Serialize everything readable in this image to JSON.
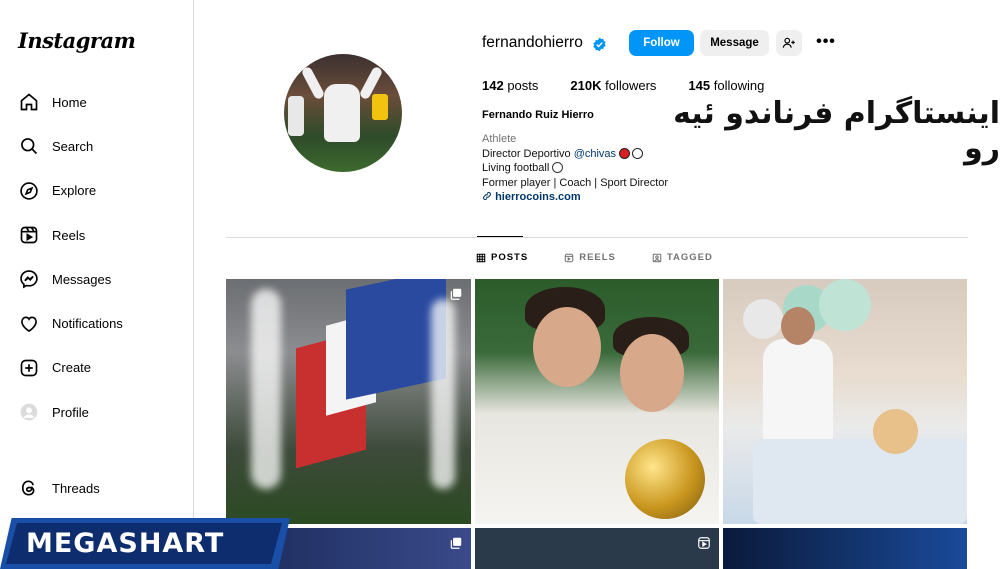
{
  "app": {
    "logo_text": "Instagram"
  },
  "sidebar": {
    "items": [
      {
        "label": "Home",
        "icon": "home-icon"
      },
      {
        "label": "Search",
        "icon": "search-icon"
      },
      {
        "label": "Explore",
        "icon": "compass-icon"
      },
      {
        "label": "Reels",
        "icon": "reels-icon"
      },
      {
        "label": "Messages",
        "icon": "messenger-icon"
      },
      {
        "label": "Notifications",
        "icon": "heart-icon"
      },
      {
        "label": "Create",
        "icon": "plus-square-icon"
      },
      {
        "label": "Profile",
        "icon": "avatar-icon"
      }
    ],
    "threads_label": "Threads"
  },
  "profile": {
    "username": "fernandohierro",
    "verified": true,
    "follow_label": "Follow",
    "message_label": "Message",
    "more_label": "•••",
    "stats": {
      "posts_count": "142",
      "posts_label": "posts",
      "followers_count": "210K",
      "followers_label": "followers",
      "following_count": "145",
      "following_label": "following"
    },
    "full_name": "Fernando Ruiz Hierro",
    "category": "Athlete",
    "bio_line1_text": "Director Deportivo ",
    "bio_line1_mention": "@chivas",
    "bio_line2": "Living football",
    "bio_line3": "Former player | Coach | Sport Director",
    "link": "hierrocoins.com"
  },
  "overlay": {
    "persian_title": "اینستاگرام فرناندو ئیه رو",
    "watermark": "MEGASHART"
  },
  "tabs": [
    {
      "label": "POSTS",
      "icon": "grid-icon",
      "active": true
    },
    {
      "label": "REELS",
      "icon": "reels-small-icon",
      "active": false
    },
    {
      "label": "TAGGED",
      "icon": "tag-icon",
      "active": false
    }
  ],
  "colors": {
    "accent": "#0095f6",
    "link": "#00376b",
    "secondary_text": "#737373",
    "watermark_blue": "#1a4fa8"
  }
}
